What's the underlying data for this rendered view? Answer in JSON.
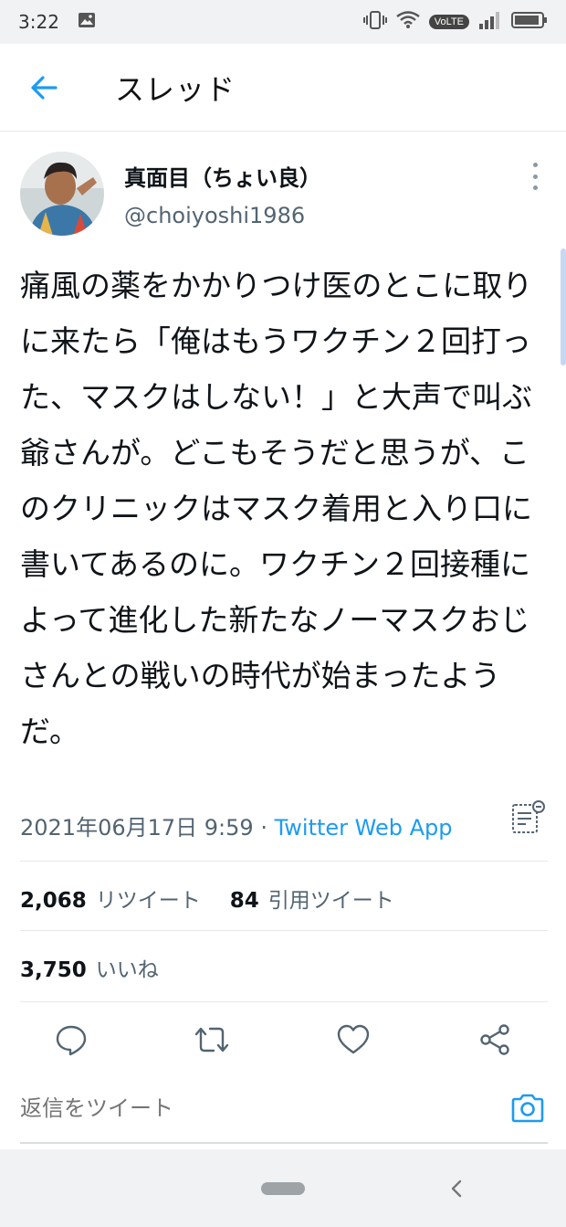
{
  "status_bar": {
    "time": "3:22",
    "volte": "VoLTE"
  },
  "header": {
    "title": "スレッド"
  },
  "tweet": {
    "display_name": "真面目（ちょい良）",
    "handle": "@choiyoshi1986",
    "text": "痛風の薬をかかりつけ医のとこに取りに来たら「俺はもうワクチン２回打った、マスクはしない！」と大声で叫ぶ爺さんが。どこもそうだと思うが、このクリニックはマスク着用と入り口に書いてあるのに。ワクチン２回接種によって進化した新たなノーマスクおじさんとの戦いの時代が始まったようだ。",
    "timestamp": "2021年06月17日 9:59",
    "separator": " · ",
    "source": "Twitter Web App"
  },
  "stats": {
    "retweets_count": "2,068",
    "retweets_label": "リツイート",
    "quotes_count": "84",
    "quotes_label": "引用ツイート",
    "likes_count": "3,750",
    "likes_label": "いいね"
  },
  "reply": {
    "placeholder": "返信をツイート"
  },
  "colors": {
    "accent": "#1d9bf0",
    "secondary_text": "#536471",
    "divider": "#e6e8ea"
  },
  "icons": [
    "back-arrow-icon",
    "more-vertical-icon",
    "analytics-icon",
    "reply-icon",
    "retweet-icon",
    "like-icon",
    "share-icon",
    "camera-icon"
  ]
}
